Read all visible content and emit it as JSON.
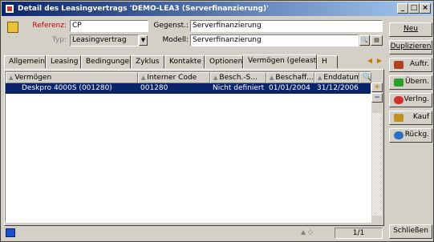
{
  "window": {
    "title": "Detail des Leasingvertrags 'DEMO-LEA3 (Serverfinanzierung)'",
    "controls": [
      "_",
      "□",
      "×"
    ]
  },
  "form": {
    "referenz_label": "Referenz:",
    "referenz_value": "CP",
    "typ_label": "Typ:",
    "typ_value": "Leasingvertrag",
    "gegenst_label": "Gegenst.:",
    "gegenst_value": "Serverfinanzierung",
    "modell_label": "Modell:",
    "modell_value": "Serverfinanzierung"
  },
  "tabs": [
    {
      "label": "Allgemein"
    },
    {
      "label": "Leasing"
    },
    {
      "label": "Bedingungen"
    },
    {
      "label": "Zyklus"
    },
    {
      "label": "Kontakte"
    },
    {
      "label": "Optionen"
    },
    {
      "label": "Vermögen (geleast)"
    },
    {
      "label": "H"
    }
  ],
  "active_tab": "Vermögen (geleast)",
  "grid": {
    "columns": [
      "Vermögen",
      "Interner Code",
      "Besch.-S...",
      "Beschaff...",
      "Enddatum"
    ],
    "rows": [
      {
        "vermoegen": "Deskpro 4000S (001280)",
        "code": "001280",
        "status": "Nicht definiert",
        "beschaff": "01/01/2004",
        "enddatum": "31/12/2006"
      }
    ],
    "side_buttons": [
      "+",
      "−"
    ]
  },
  "status": {
    "pager": "1/1"
  },
  "sidebar": {
    "buttons": [
      {
        "label": "Neu",
        "icon": "none"
      },
      {
        "label": "Duplizieren",
        "icon": "none"
      },
      {
        "label": "Auftr.",
        "icon": "order-icon"
      },
      {
        "label": "Übern.",
        "icon": "check-icon"
      },
      {
        "label": "Verlng.",
        "icon": "extend-icon"
      },
      {
        "label": "Kauf",
        "icon": "purchase-icon"
      },
      {
        "label": "Rückg.",
        "icon": "return-icon"
      },
      {
        "label": "Schließen",
        "icon": "none"
      }
    ]
  },
  "colors": {
    "title_start": "#0a246a",
    "title_end": "#a6caf0",
    "selection": "#0a246a",
    "required_label": "#c00000"
  }
}
